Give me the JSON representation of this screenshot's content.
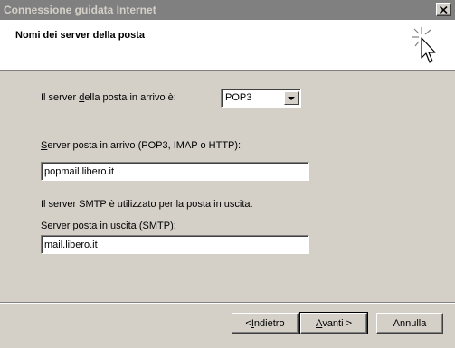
{
  "window": {
    "title": "Connessione guidata Internet"
  },
  "header": {
    "title": "Nomi dei server della posta"
  },
  "incoming_type": {
    "label_pre": "Il server ",
    "label_accel": "d",
    "label_post": "ella posta in arrivo è:",
    "value": "POP3"
  },
  "incoming_server": {
    "label_accel": "S",
    "label_post": "erver posta in arrivo (POP3, IMAP o HTTP):",
    "value": "popmail.libero.it"
  },
  "smtp_note": "Il server SMTP è utilizzato per la posta in uscita.",
  "outgoing_server": {
    "label_pre": "Server posta in ",
    "label_accel": "u",
    "label_post": "scita (SMTP):",
    "value": "mail.libero.it"
  },
  "buttons": {
    "back_pre": "< ",
    "back_accel": "I",
    "back_post": "ndietro",
    "next_accel": "A",
    "next_post": "vanti >",
    "cancel": "Annulla"
  },
  "icons": {
    "close": "close-icon",
    "wizard": "wizard-cursor-icon"
  }
}
